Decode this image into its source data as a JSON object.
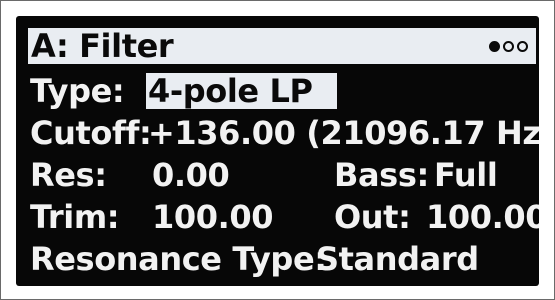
{
  "header": {
    "title": "A: Filter",
    "page_dots": [
      {
        "state": "filled",
        "icon": "filled-circle-icon"
      },
      {
        "state": "empty",
        "icon": "hollow-circle-icon"
      },
      {
        "state": "empty",
        "icon": "hollow-circle-icon"
      }
    ]
  },
  "params": {
    "type": {
      "label": "Type:",
      "value": "4-pole LP"
    },
    "cutoff": {
      "label": "Cutoff:",
      "value": "+136.00 (21096.17 Hz)"
    },
    "res": {
      "label": "Res:",
      "value": "0.00"
    },
    "bass": {
      "label": "Bass:",
      "value": "Full"
    },
    "trim": {
      "label": "Trim:",
      "value": "100.00"
    },
    "out": {
      "label": "Out:",
      "value": "100.00"
    },
    "resonance_type": {
      "label": "Resonance Type:",
      "value": "Standard"
    }
  },
  "colors": {
    "screen_bg": "#070707",
    "text": "#f2f2f2",
    "highlight_bg": "#e9edf2",
    "highlight_text": "#0a0a0a"
  }
}
